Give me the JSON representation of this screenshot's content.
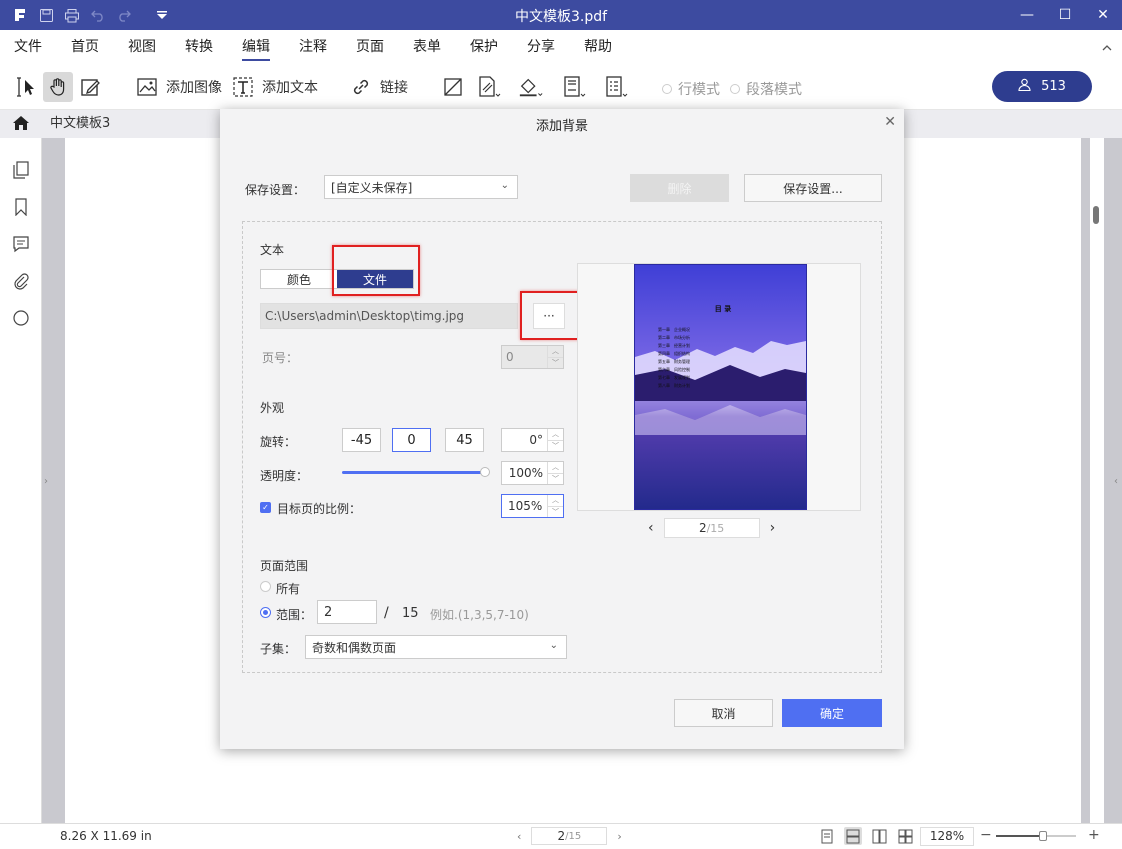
{
  "window": {
    "title": "中文模板3.pdf",
    "quick_icons": [
      "app-logo-icon",
      "save-icon",
      "print-icon",
      "undo-icon",
      "redo-icon",
      "quick-access-dropdown-icon"
    ],
    "controls": {
      "minimize": "—",
      "maximize": "☐",
      "close": "✕"
    }
  },
  "menu": {
    "items": [
      "文件",
      "首页",
      "视图",
      "转换",
      "编辑",
      "注释",
      "页面",
      "表单",
      "保护",
      "分享",
      "帮助"
    ],
    "active": "编辑"
  },
  "toolbar": {
    "add_image": "添加图像",
    "add_text": "添加文本",
    "link": "链接",
    "line_mode": "行模式",
    "paragraph_mode": "段落模式",
    "user_count": "513"
  },
  "tab": {
    "doc_name": "中文模板3"
  },
  "status": {
    "dimensions": "8.26 X 11.69 in",
    "current_page": "2",
    "total_pages": "/15",
    "zoom": "128%"
  },
  "dialog": {
    "title": "添加背景",
    "save_settings_label": "保存设置：",
    "save_settings_value": "[自定义未保存]",
    "delete_button": "删除",
    "save_settings_button": "保存设置...",
    "source_section": "文本",
    "seg_color": "颜色",
    "seg_file": "文件",
    "file_path": "C:\\Users\\admin\\Desktop\\timg.jpg",
    "browse_button": "···",
    "page_number_label": "页号：",
    "page_number_value": "0",
    "appearance_section": "外观",
    "rotation_label": "旋转：",
    "rotation_presets": [
      "-45",
      "0",
      "45"
    ],
    "rotation_value": "0",
    "rotation_unit": "°",
    "opacity_label": "透明度：",
    "opacity_value": "100",
    "opacity_unit": "%",
    "opacity_level": 1.0,
    "scale_checkbox_label": "目标页的比例：",
    "scale_value": "105",
    "scale_unit": "%",
    "page_range_section": "页面范围",
    "all_label": "所有",
    "range_label": "范围：",
    "range_value": "2",
    "range_total_sep": "/",
    "range_total": "15",
    "range_example": "例如.(1,3,5,7-10)",
    "subset_label": "子集：",
    "subset_value": "奇数和偶数页面",
    "preview_page": "2",
    "preview_total": "/15",
    "preview_page_title": "目    录",
    "preview_toc": [
      "第一章　企业概况",
      "第二章　市场分析",
      "第三章　经营计划",
      "第四章　组织结构",
      "第五章　财务管理",
      "第六章　风险控制",
      "第七章　发展规划",
      "第八章　财务计划"
    ],
    "cancel_button": "取消",
    "ok_button": "确定"
  }
}
